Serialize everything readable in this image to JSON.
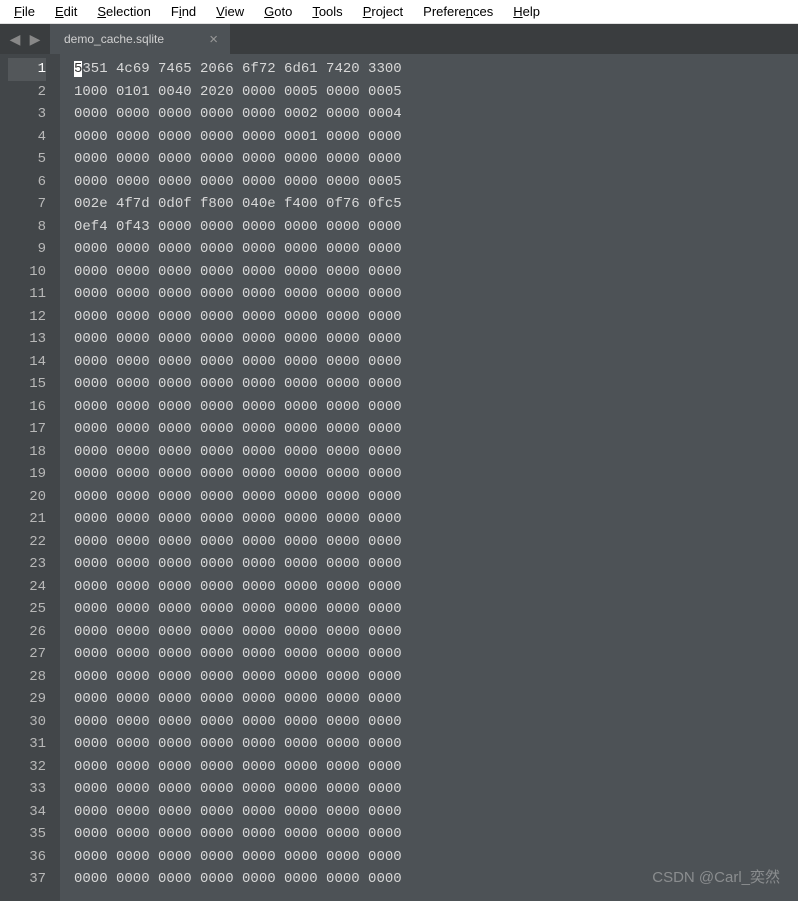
{
  "menubar": {
    "items": [
      {
        "key": "F",
        "rest": "ile"
      },
      {
        "key": "E",
        "rest": "dit"
      },
      {
        "key": "S",
        "rest": "election"
      },
      {
        "key": "i",
        "prefix": "F",
        "rest": "nd"
      },
      {
        "key": "V",
        "rest": "iew"
      },
      {
        "key": "G",
        "rest": "oto"
      },
      {
        "key": "T",
        "rest": "ools"
      },
      {
        "key": "P",
        "rest": "roject"
      },
      {
        "key": "n",
        "prefix": "Prefere",
        "rest": "ces"
      },
      {
        "key": "H",
        "rest": "elp"
      }
    ]
  },
  "nav": {
    "back": "◀",
    "forward": "▶"
  },
  "tab": {
    "title": "demo_cache.sqlite",
    "close": "×"
  },
  "editor": {
    "cursor_char": "5",
    "lines": [
      "351 4c69 7465 2066 6f72 6d61 7420 3300",
      "1000 0101 0040 2020 0000 0005 0000 0005",
      "0000 0000 0000 0000 0000 0002 0000 0004",
      "0000 0000 0000 0000 0000 0001 0000 0000",
      "0000 0000 0000 0000 0000 0000 0000 0000",
      "0000 0000 0000 0000 0000 0000 0000 0005",
      "002e 4f7d 0d0f f800 040e f400 0f76 0fc5",
      "0ef4 0f43 0000 0000 0000 0000 0000 0000",
      "0000 0000 0000 0000 0000 0000 0000 0000",
      "0000 0000 0000 0000 0000 0000 0000 0000",
      "0000 0000 0000 0000 0000 0000 0000 0000",
      "0000 0000 0000 0000 0000 0000 0000 0000",
      "0000 0000 0000 0000 0000 0000 0000 0000",
      "0000 0000 0000 0000 0000 0000 0000 0000",
      "0000 0000 0000 0000 0000 0000 0000 0000",
      "0000 0000 0000 0000 0000 0000 0000 0000",
      "0000 0000 0000 0000 0000 0000 0000 0000",
      "0000 0000 0000 0000 0000 0000 0000 0000",
      "0000 0000 0000 0000 0000 0000 0000 0000",
      "0000 0000 0000 0000 0000 0000 0000 0000",
      "0000 0000 0000 0000 0000 0000 0000 0000",
      "0000 0000 0000 0000 0000 0000 0000 0000",
      "0000 0000 0000 0000 0000 0000 0000 0000",
      "0000 0000 0000 0000 0000 0000 0000 0000",
      "0000 0000 0000 0000 0000 0000 0000 0000",
      "0000 0000 0000 0000 0000 0000 0000 0000",
      "0000 0000 0000 0000 0000 0000 0000 0000",
      "0000 0000 0000 0000 0000 0000 0000 0000",
      "0000 0000 0000 0000 0000 0000 0000 0000",
      "0000 0000 0000 0000 0000 0000 0000 0000",
      "0000 0000 0000 0000 0000 0000 0000 0000",
      "0000 0000 0000 0000 0000 0000 0000 0000",
      "0000 0000 0000 0000 0000 0000 0000 0000",
      "0000 0000 0000 0000 0000 0000 0000 0000",
      "0000 0000 0000 0000 0000 0000 0000 0000",
      "0000 0000 0000 0000 0000 0000 0000 0000",
      "0000 0000 0000 0000 0000 0000 0000 0000"
    ]
  },
  "watermark": "CSDN @Carl_奕然"
}
